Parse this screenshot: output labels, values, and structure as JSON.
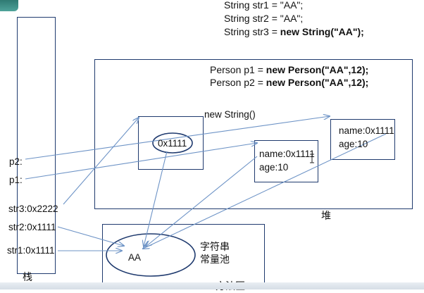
{
  "code_top": {
    "line1": "String str1 = \"AA\";",
    "line2": "String str2 = \"AA\";",
    "line3_plain": "String str3 = ",
    "line3_bold": "new String(\"AA\");"
  },
  "code_heap": {
    "line1_plain": "Person p1 = ",
    "line1_bold": "new Person(\"AA\",12);",
    "line2_plain": "Person p2 = ",
    "line2_bold": "new Person(\"AA\",12);"
  },
  "new_string_label": "new String()",
  "string_object_value": "0x1111",
  "person1": {
    "name": "name:0x1111",
    "age": "age:10"
  },
  "person2": {
    "name": "name:0x1111",
    "age": "age:10"
  },
  "stack": {
    "p2": "p2:",
    "p1": "p1:",
    "str3": "str3:0x2222",
    "str2": "str2:0x1111",
    "str1": "str1:0x1111",
    "label": "栈"
  },
  "heap_label": "堆",
  "pool": {
    "value": "AA",
    "label_line1": "字符串",
    "label_line2": "常量池"
  },
  "method_area_label": "方法区",
  "colors": {
    "box_border": "#1f3a6e",
    "arrow": "#6d93c6"
  }
}
